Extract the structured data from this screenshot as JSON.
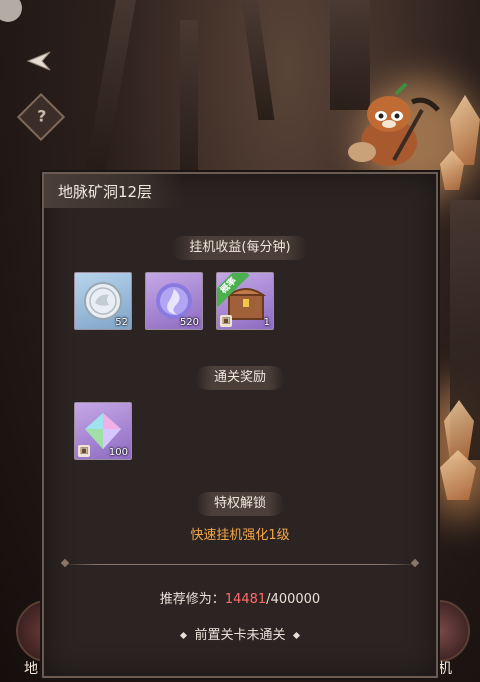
{
  "dialog": {
    "title": "地脉矿洞12层"
  },
  "sections": {
    "idle_rewards_label": "挂机收益(每分钟)",
    "clear_rewards_label": "通关奖励",
    "privilege_label": "特权解锁"
  },
  "idle_items": [
    {
      "icon": "silver-coin-icon",
      "count": "52",
      "rarity": "blue"
    },
    {
      "icon": "spirit-orb-icon",
      "count": "520",
      "rarity": "purple"
    },
    {
      "icon": "treasure-chest-icon",
      "count": "1",
      "rarity": "purple",
      "tag": "概率"
    }
  ],
  "clear_items": [
    {
      "icon": "crystal-gem-icon",
      "count": "100",
      "rarity": "purple"
    }
  ],
  "privilege": {
    "text": "快速挂机强化1级"
  },
  "recommend": {
    "label": "推荐修为：",
    "current": "14481",
    "separator": "/",
    "required": "400000"
  },
  "status": {
    "text": "前置关卡未通关"
  },
  "background": {
    "bottom_left_label": "地",
    "bottom_right_label": "机"
  },
  "colors": {
    "privilege": "#f5a64a",
    "current_power": "#ff6b6b",
    "probability_tag": "#4caf50"
  }
}
